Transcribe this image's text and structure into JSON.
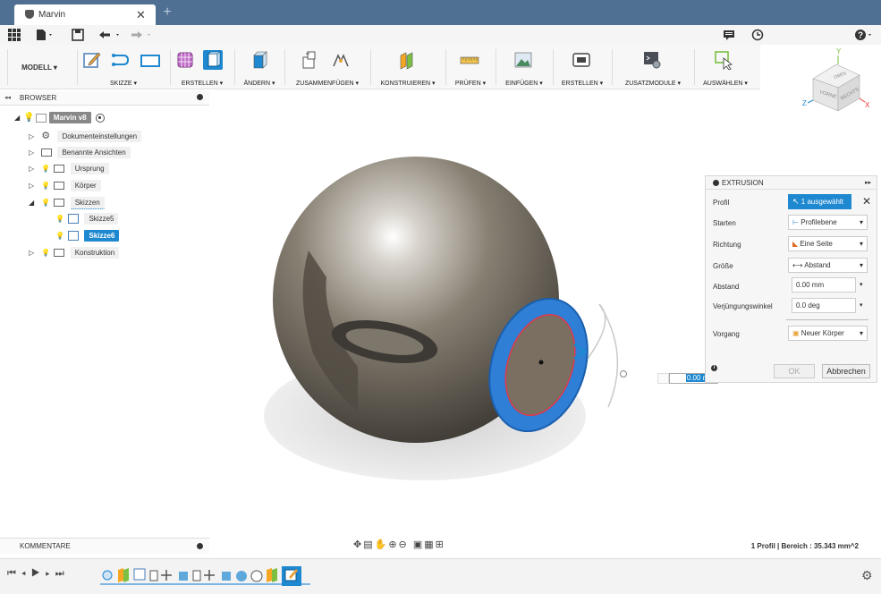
{
  "tab": {
    "title": "Marvin",
    "close": "✕",
    "new": "+"
  },
  "ribbon": {
    "workspace": "MODELL ▾",
    "groups": {
      "skizze": "SKIZZE ▾",
      "erstellen": "ERSTELLEN ▾",
      "aendern": "ÄNDERN ▾",
      "zusammenfuegen": "ZUSAMMENFÜGEN ▾",
      "konstruieren": "KONSTRUIEREN ▾",
      "pruefen": "PRÜFEN ▾",
      "einfuegen": "EINFÜGEN ▾",
      "erstellen2": "ERSTELLEN ▾",
      "zusatzmodule": "ZUSATZMODULE ▾",
      "auswaehlen": "AUSWÄHLEN ▾"
    }
  },
  "viewcube": {
    "top": "OBEN",
    "front": "VORNE",
    "right": "RECHTS",
    "axis_x": "X",
    "axis_y": "Y",
    "axis_z": "Z"
  },
  "browser": {
    "title": "BROWSER",
    "root": "Marvin v8",
    "items": [
      {
        "label": "Dokumenteinstellungen"
      },
      {
        "label": "Benannte Ansichten"
      },
      {
        "label": "Ursprung"
      },
      {
        "label": "Körper"
      },
      {
        "label": "Skizzen"
      },
      {
        "label": "Skizze5"
      },
      {
        "label": "Skizze6"
      },
      {
        "label": "Konstruktion"
      }
    ]
  },
  "extrusion": {
    "title": "EXTRUSION",
    "rows": [
      {
        "label": "Profil",
        "value": "1 ausgewählt"
      },
      {
        "label": "Starten",
        "value": "Profilebene"
      },
      {
        "label": "Richtung",
        "value": "Eine Seite"
      },
      {
        "label": "Größe",
        "value": "Abstand"
      },
      {
        "label": "Abstand",
        "value": "0.00 mm"
      },
      {
        "label": "Verjüngungswinkel",
        "value": "0.0 deg"
      },
      {
        "label": "Vorgang",
        "value": "Neuer Körper"
      }
    ],
    "ok": "OK",
    "cancel": "Abbrechen",
    "info": "i"
  },
  "canvas_input": {
    "value": "0.00 mm"
  },
  "comments": {
    "label": "KOMMENTARE"
  },
  "status": {
    "text": "1 Profil | Bereich : 35.343 mm^2"
  },
  "colors": {
    "accent": "#1e88d0",
    "titlebar": "#4f6f93",
    "sphere": "#7a7367"
  }
}
